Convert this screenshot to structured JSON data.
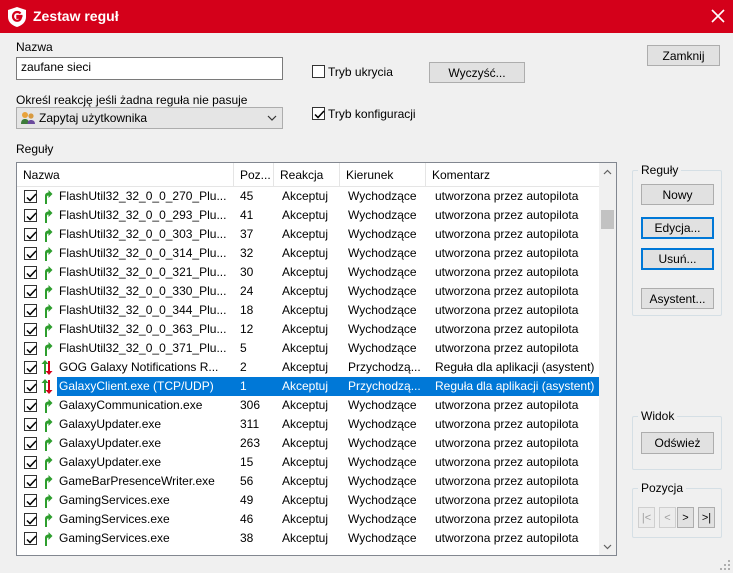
{
  "window": {
    "title": "Zestaw reguł",
    "logo_icon": "gdata-shield-icon",
    "close_icon": "close-icon"
  },
  "form": {
    "name_label": "Nazwa",
    "name_value": "zaufane sieci",
    "hidden_mode_label": "Tryb ukrycia",
    "hidden_mode_checked": false,
    "clear_button": "Wyczyść...",
    "close_button": "Zamknij",
    "default_reaction_label": "Określ reakcję jeśli żadna reguła nie pasuje",
    "default_reaction_value": "Zapytaj użytkownika",
    "config_mode_label": "Tryb konfiguracji",
    "config_mode_checked": true,
    "rules_label": "Reguły"
  },
  "table": {
    "columns": [
      "Nazwa",
      "Poz...",
      "Reakcja",
      "Kierunek",
      "Komentarz"
    ],
    "rows": [
      {
        "icon": "green-arrow-icon",
        "name": "FlashUtil32_32_0_0_270_Plu...",
        "pos": "45",
        "reaction": "Akceptuj",
        "direction": "Wychodzące",
        "comment": "utworzona przez autopilota",
        "checked": true,
        "selected": false
      },
      {
        "icon": "green-arrow-icon",
        "name": "FlashUtil32_32_0_0_293_Plu...",
        "pos": "41",
        "reaction": "Akceptuj",
        "direction": "Wychodzące",
        "comment": "utworzona przez autopilota",
        "checked": true,
        "selected": false
      },
      {
        "icon": "green-arrow-icon",
        "name": "FlashUtil32_32_0_0_303_Plu...",
        "pos": "37",
        "reaction": "Akceptuj",
        "direction": "Wychodzące",
        "comment": "utworzona przez autopilota",
        "checked": true,
        "selected": false
      },
      {
        "icon": "green-arrow-icon",
        "name": "FlashUtil32_32_0_0_314_Plu...",
        "pos": "32",
        "reaction": "Akceptuj",
        "direction": "Wychodzące",
        "comment": "utworzona przez autopilota",
        "checked": true,
        "selected": false
      },
      {
        "icon": "green-arrow-icon",
        "name": "FlashUtil32_32_0_0_321_Plu...",
        "pos": "30",
        "reaction": "Akceptuj",
        "direction": "Wychodzące",
        "comment": "utworzona przez autopilota",
        "checked": true,
        "selected": false
      },
      {
        "icon": "green-arrow-icon",
        "name": "FlashUtil32_32_0_0_330_Plu...",
        "pos": "24",
        "reaction": "Akceptuj",
        "direction": "Wychodzące",
        "comment": "utworzona przez autopilota",
        "checked": true,
        "selected": false
      },
      {
        "icon": "green-arrow-icon",
        "name": "FlashUtil32_32_0_0_344_Plu...",
        "pos": "18",
        "reaction": "Akceptuj",
        "direction": "Wychodzące",
        "comment": "utworzona przez autopilota",
        "checked": true,
        "selected": false
      },
      {
        "icon": "green-arrow-icon",
        "name": "FlashUtil32_32_0_0_363_Plu...",
        "pos": "12",
        "reaction": "Akceptuj",
        "direction": "Wychodzące",
        "comment": "utworzona przez autopilota",
        "checked": true,
        "selected": false
      },
      {
        "icon": "green-arrow-icon",
        "name": "FlashUtil32_32_0_0_371_Plu...",
        "pos": "5",
        "reaction": "Akceptuj",
        "direction": "Wychodzące",
        "comment": "utworzona przez autopilota",
        "checked": true,
        "selected": false
      },
      {
        "icon": "bidirectional-arrows-icon",
        "name": "GOG Galaxy Notifications R...",
        "pos": "2",
        "reaction": "Akceptuj",
        "direction": "Przychodzą...",
        "comment": "Reguła dla aplikacji (asystent)",
        "checked": true,
        "selected": false
      },
      {
        "icon": "bidirectional-arrows-icon",
        "name": "GalaxyClient.exe (TCP/UDP)",
        "pos": "1",
        "reaction": "Akceptuj",
        "direction": "Przychodzą...",
        "comment": "Reguła dla aplikacji (asystent)",
        "checked": true,
        "selected": true
      },
      {
        "icon": "green-arrow-icon",
        "name": "GalaxyCommunication.exe",
        "pos": "306",
        "reaction": "Akceptuj",
        "direction": "Wychodzące",
        "comment": "utworzona przez autopilota",
        "checked": true,
        "selected": false
      },
      {
        "icon": "green-arrow-icon",
        "name": "GalaxyUpdater.exe",
        "pos": "311",
        "reaction": "Akceptuj",
        "direction": "Wychodzące",
        "comment": "utworzona przez autopilota",
        "checked": true,
        "selected": false
      },
      {
        "icon": "green-arrow-icon",
        "name": "GalaxyUpdater.exe",
        "pos": "263",
        "reaction": "Akceptuj",
        "direction": "Wychodzące",
        "comment": "utworzona przez autopilota",
        "checked": true,
        "selected": false
      },
      {
        "icon": "green-arrow-icon",
        "name": "GalaxyUpdater.exe",
        "pos": "15",
        "reaction": "Akceptuj",
        "direction": "Wychodzące",
        "comment": "utworzona przez autopilota",
        "checked": true,
        "selected": false
      },
      {
        "icon": "green-arrow-icon",
        "name": "GameBarPresenceWriter.exe",
        "pos": "56",
        "reaction": "Akceptuj",
        "direction": "Wychodzące",
        "comment": "utworzona przez autopilota",
        "checked": true,
        "selected": false
      },
      {
        "icon": "green-arrow-icon",
        "name": "GamingServices.exe",
        "pos": "49",
        "reaction": "Akceptuj",
        "direction": "Wychodzące",
        "comment": "utworzona przez autopilota",
        "checked": true,
        "selected": false
      },
      {
        "icon": "green-arrow-icon",
        "name": "GamingServices.exe",
        "pos": "46",
        "reaction": "Akceptuj",
        "direction": "Wychodzące",
        "comment": "utworzona przez autopilota",
        "checked": true,
        "selected": false
      },
      {
        "icon": "green-arrow-icon",
        "name": "GamingServices.exe",
        "pos": "38",
        "reaction": "Akceptuj",
        "direction": "Wychodzące",
        "comment": "utworzona przez autopilota",
        "checked": true,
        "selected": false
      }
    ]
  },
  "rules_group": {
    "title": "Reguły",
    "new_button": "Nowy",
    "edit_button": "Edycja...",
    "delete_button": "Usuń...",
    "wizard_button": "Asystent..."
  },
  "view_group": {
    "title": "Widok",
    "refresh_button": "Odśwież"
  },
  "position_group": {
    "title": "Pozycja",
    "first": "|<",
    "prev": "<",
    "next": ">",
    "last": ">|"
  },
  "colors": {
    "titlebar": "#d4001a",
    "selection": "#0078d7",
    "arrow_green": "#2e9e2e",
    "arrow_red": "#d4001a"
  }
}
